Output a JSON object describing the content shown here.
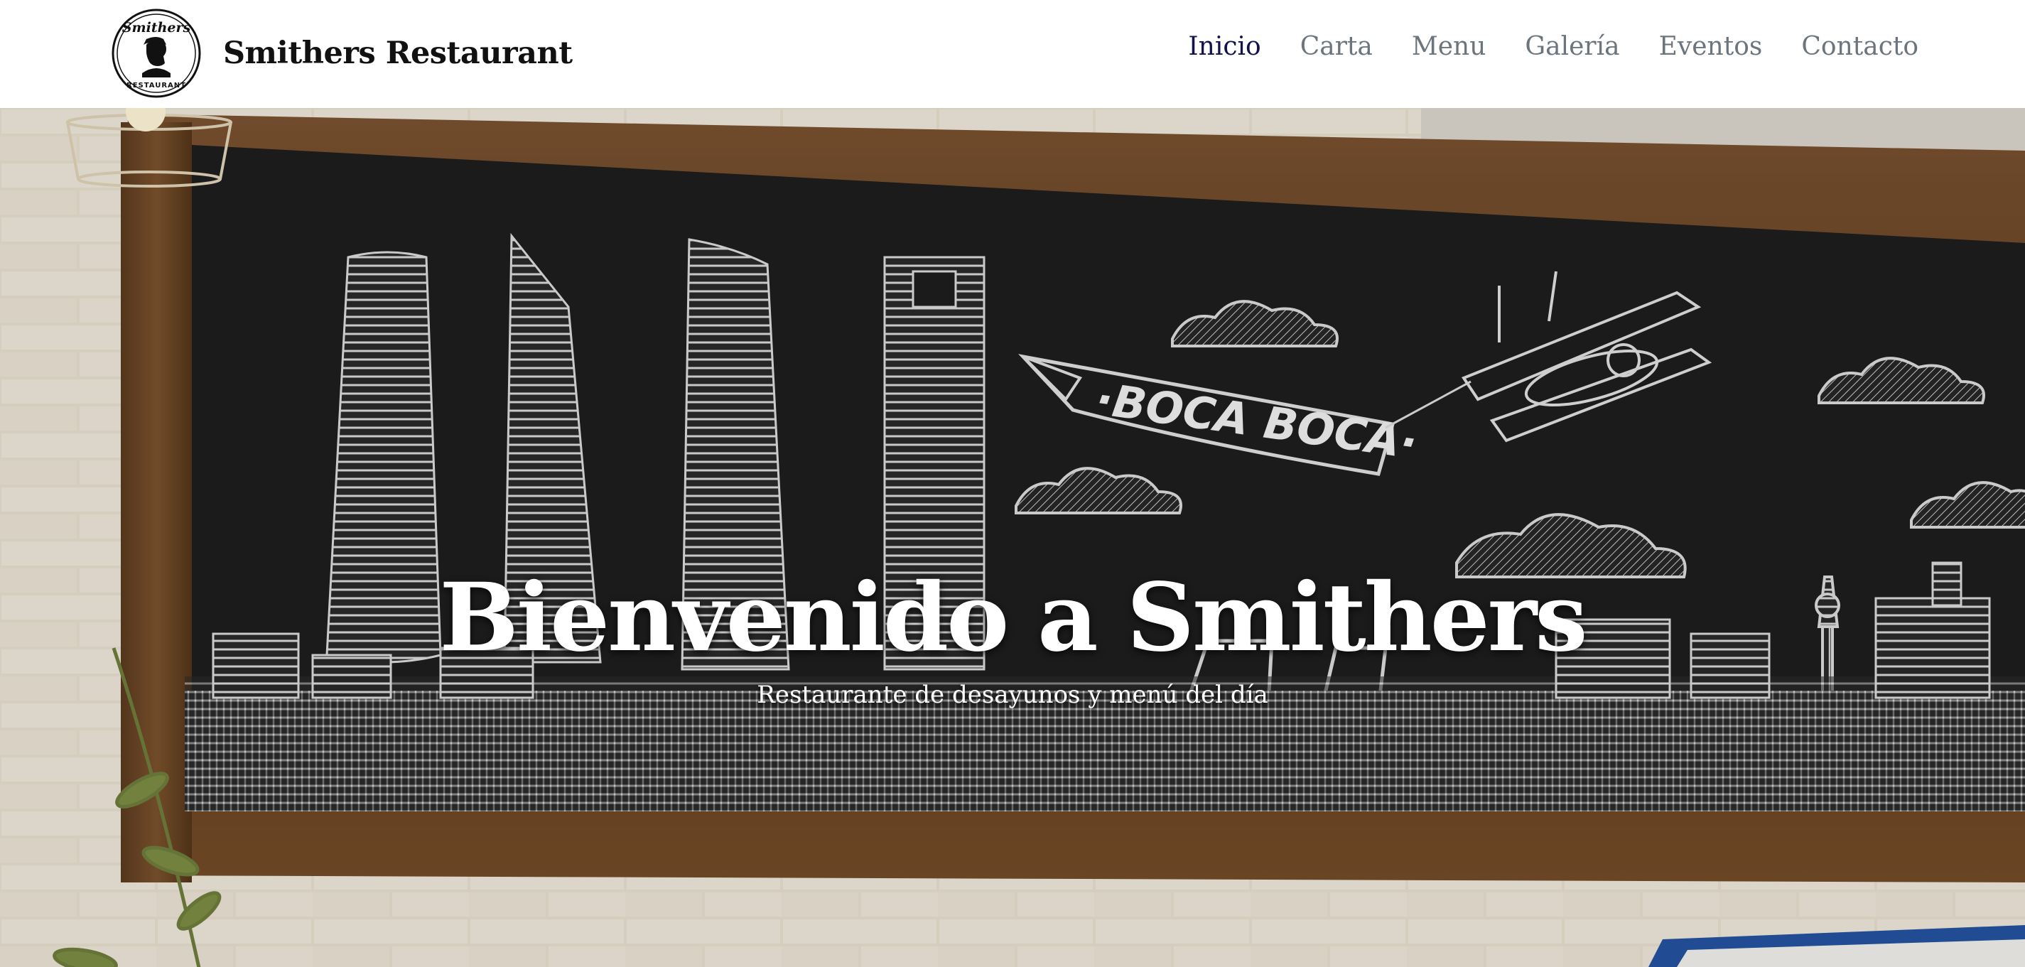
{
  "navbar": {
    "brand_name": "Smithers Restaurant",
    "logo_text_top": "Smithers",
    "logo_text_bottom": "RESTAURANT",
    "items": [
      {
        "label": "Inicio",
        "active": true
      },
      {
        "label": "Carta"
      },
      {
        "label": "Menu"
      },
      {
        "label": "Galería"
      },
      {
        "label": "Eventos"
      },
      {
        "label": "Contacto"
      }
    ]
  },
  "hero": {
    "title": "Bienvenido a Smithers",
    "subtitle": "Restaurante de desayunos y menú del día",
    "banner_text": "·BOCA BOCA·",
    "background_icon": "chalkboard-skyline-illustration"
  },
  "colors": {
    "nav_active": "#13124e",
    "nav_inactive": "#6c757d",
    "brand": "#111111",
    "chalkboard": "#1d1d1d",
    "frame": "#6b4524",
    "brick": "#e6dccb"
  }
}
